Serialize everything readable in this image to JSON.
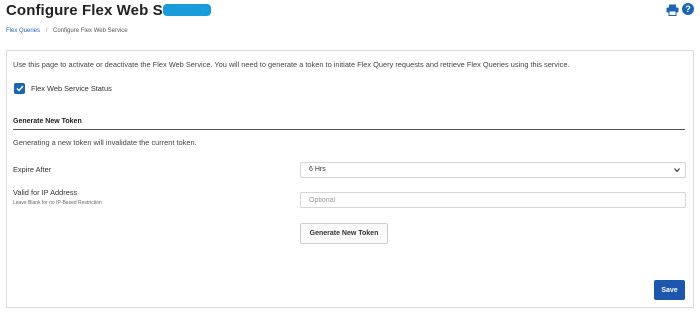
{
  "header": {
    "title": "Configure Flex Web Service",
    "print_icon": "printer-icon",
    "help_icon": "help-icon",
    "help_glyph": "?",
    "accent": "#1c64b4",
    "badge_color": "#1a9cdb"
  },
  "breadcrumb": {
    "items": [
      "Flex Queries",
      "Configure Flex Web Service"
    ],
    "separator": "/"
  },
  "main": {
    "intro": "Use this page to activate or deactivate the Flex Web Service. You will need to generate a token to initiate Flex Query requests and retrieve Flex Queries using this service.",
    "status": {
      "label": "Flex Web Service Status",
      "checked": true
    },
    "token_section": {
      "title": "Generate New Token",
      "warning": "Generating a new token will invalidate the current token.",
      "expire": {
        "label": "Expire After",
        "selected": "6 Hrs"
      },
      "ip": {
        "label": "Valid for IP Address",
        "hint": "Leave Blank for no IP-Based Restriction",
        "value": "",
        "placeholder": "Optional"
      },
      "generate_label": "Generate New Token"
    },
    "save_label": "Save",
    "save_color": "#1c56ad"
  }
}
